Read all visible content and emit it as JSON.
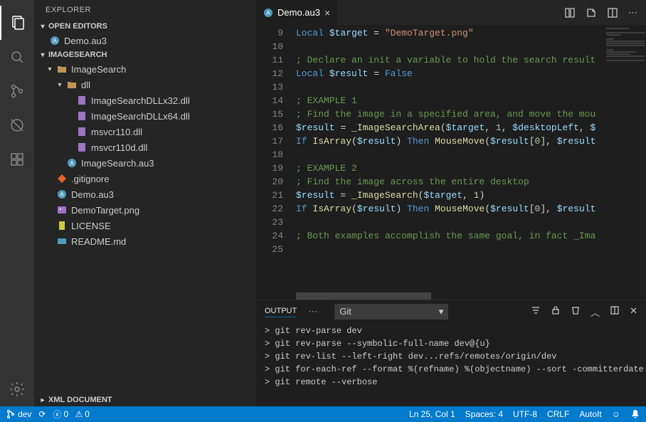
{
  "sidebar": {
    "title": "EXPLORER",
    "sections": {
      "openEditors": {
        "label": "OPEN EDITORS",
        "items": [
          {
            "label": "Demo.au3",
            "iconColor": "#519aba"
          }
        ]
      },
      "workspace": {
        "label": "IMAGESEARCH"
      },
      "xml": {
        "label": "XML DOCUMENT"
      }
    },
    "tree": [
      {
        "indent": 1,
        "twist": "▾",
        "icon": "folder",
        "label": "ImageSearch"
      },
      {
        "indent": 2,
        "twist": "▾",
        "icon": "folder",
        "label": "dll"
      },
      {
        "indent": 3,
        "twist": "",
        "icon": "dll",
        "label": "ImageSearchDLLx32.dll"
      },
      {
        "indent": 3,
        "twist": "",
        "icon": "dll",
        "label": "ImageSearchDLLx64.dll"
      },
      {
        "indent": 3,
        "twist": "",
        "icon": "dll",
        "label": "msvcr110.dll"
      },
      {
        "indent": 3,
        "twist": "",
        "icon": "dll",
        "label": "msvcr110d.dll"
      },
      {
        "indent": 2,
        "twist": "",
        "icon": "au3",
        "label": "ImageSearch.au3"
      },
      {
        "indent": 1,
        "twist": "",
        "icon": "git",
        "label": ".gitignore"
      },
      {
        "indent": 1,
        "twist": "",
        "icon": "au3",
        "label": "Demo.au3"
      },
      {
        "indent": 1,
        "twist": "",
        "icon": "img",
        "label": "DemoTarget.png"
      },
      {
        "indent": 1,
        "twist": "",
        "icon": "lic",
        "label": "LICENSE"
      },
      {
        "indent": 1,
        "twist": "",
        "icon": "md",
        "label": "README.md"
      }
    ]
  },
  "editor": {
    "tab": {
      "label": "Demo.au3",
      "iconColor": "#519aba"
    },
    "lines": [
      {
        "n": 9,
        "tokens": [
          [
            "kw",
            "Local"
          ],
          [
            "txt",
            " "
          ],
          [
            "var",
            "$target"
          ],
          [
            "txt",
            " = "
          ],
          [
            "str",
            "\"DemoTarget.png\""
          ]
        ]
      },
      {
        "n": 10,
        "tokens": []
      },
      {
        "n": 11,
        "tokens": [
          [
            "cmt",
            "; Declare an init a variable to hold the search result"
          ]
        ]
      },
      {
        "n": 12,
        "tokens": [
          [
            "kw",
            "Local"
          ],
          [
            "txt",
            " "
          ],
          [
            "var",
            "$result"
          ],
          [
            "txt",
            " = "
          ],
          [
            "const",
            "False"
          ]
        ]
      },
      {
        "n": 13,
        "tokens": []
      },
      {
        "n": 14,
        "tokens": [
          [
            "cmt",
            "; EXAMPLE 1"
          ]
        ]
      },
      {
        "n": 15,
        "tokens": [
          [
            "cmt",
            "; Find the image in a specified area, and move the mou"
          ]
        ]
      },
      {
        "n": 16,
        "tokens": [
          [
            "var",
            "$result"
          ],
          [
            "txt",
            " = "
          ],
          [
            "fn",
            "_ImageSearchArea"
          ],
          [
            "txt",
            "("
          ],
          [
            "var",
            "$target"
          ],
          [
            "txt",
            ", "
          ],
          [
            "num",
            "1"
          ],
          [
            "txt",
            ", "
          ],
          [
            "var",
            "$desktopLeft"
          ],
          [
            "txt",
            ", "
          ],
          [
            "var",
            "$"
          ]
        ]
      },
      {
        "n": 17,
        "tokens": [
          [
            "kw",
            "If"
          ],
          [
            "txt",
            " "
          ],
          [
            "fn",
            "IsArray"
          ],
          [
            "txt",
            "("
          ],
          [
            "var",
            "$result"
          ],
          [
            "txt",
            ") "
          ],
          [
            "kw",
            "Then"
          ],
          [
            "txt",
            " "
          ],
          [
            "fn",
            "MouseMove"
          ],
          [
            "txt",
            "("
          ],
          [
            "var",
            "$result"
          ],
          [
            "txt",
            "["
          ],
          [
            "num",
            "0"
          ],
          [
            "txt",
            "], "
          ],
          [
            "var",
            "$result"
          ]
        ]
      },
      {
        "n": 18,
        "tokens": []
      },
      {
        "n": 19,
        "tokens": [
          [
            "cmt",
            "; EXAMPLE 2"
          ]
        ]
      },
      {
        "n": 20,
        "tokens": [
          [
            "cmt",
            "; Find the image across the entire desktop"
          ]
        ]
      },
      {
        "n": 21,
        "tokens": [
          [
            "var",
            "$result"
          ],
          [
            "txt",
            " = "
          ],
          [
            "fn",
            "_ImageSearch"
          ],
          [
            "txt",
            "("
          ],
          [
            "var",
            "$target"
          ],
          [
            "txt",
            ", "
          ],
          [
            "num",
            "1"
          ],
          [
            "txt",
            ")"
          ]
        ]
      },
      {
        "n": 22,
        "tokens": [
          [
            "kw",
            "If"
          ],
          [
            "txt",
            " "
          ],
          [
            "fn",
            "IsArray"
          ],
          [
            "txt",
            "("
          ],
          [
            "var",
            "$result"
          ],
          [
            "txt",
            ") "
          ],
          [
            "kw",
            "Then"
          ],
          [
            "txt",
            " "
          ],
          [
            "fn",
            "MouseMove"
          ],
          [
            "txt",
            "("
          ],
          [
            "var",
            "$result"
          ],
          [
            "txt",
            "["
          ],
          [
            "num",
            "0"
          ],
          [
            "txt",
            "], "
          ],
          [
            "var",
            "$result"
          ]
        ]
      },
      {
        "n": 23,
        "tokens": []
      },
      {
        "n": 24,
        "tokens": [
          [
            "cmt",
            "; Both examples accomplish the same goal, in fact _Ima"
          ]
        ]
      },
      {
        "n": 25,
        "tokens": []
      }
    ]
  },
  "panel": {
    "tabs": {
      "output": "OUTPUT"
    },
    "select": "Git",
    "body": [
      "> git rev-parse dev",
      "> git rev-parse --symbolic-full-name dev@{u}",
      "> git rev-list --left-right dev...refs/remotes/origin/dev",
      "> git for-each-ref --format %(refname) %(objectname) --sort -committerdate",
      "> git remote --verbose"
    ]
  },
  "status": {
    "branch": "dev",
    "sync": "⟳",
    "errors": "0",
    "warnings": "0",
    "lncol": "Ln 25, Col 1",
    "spaces": "Spaces: 4",
    "encoding": "UTF-8",
    "eol": "CRLF",
    "lang": "AutoIt"
  }
}
